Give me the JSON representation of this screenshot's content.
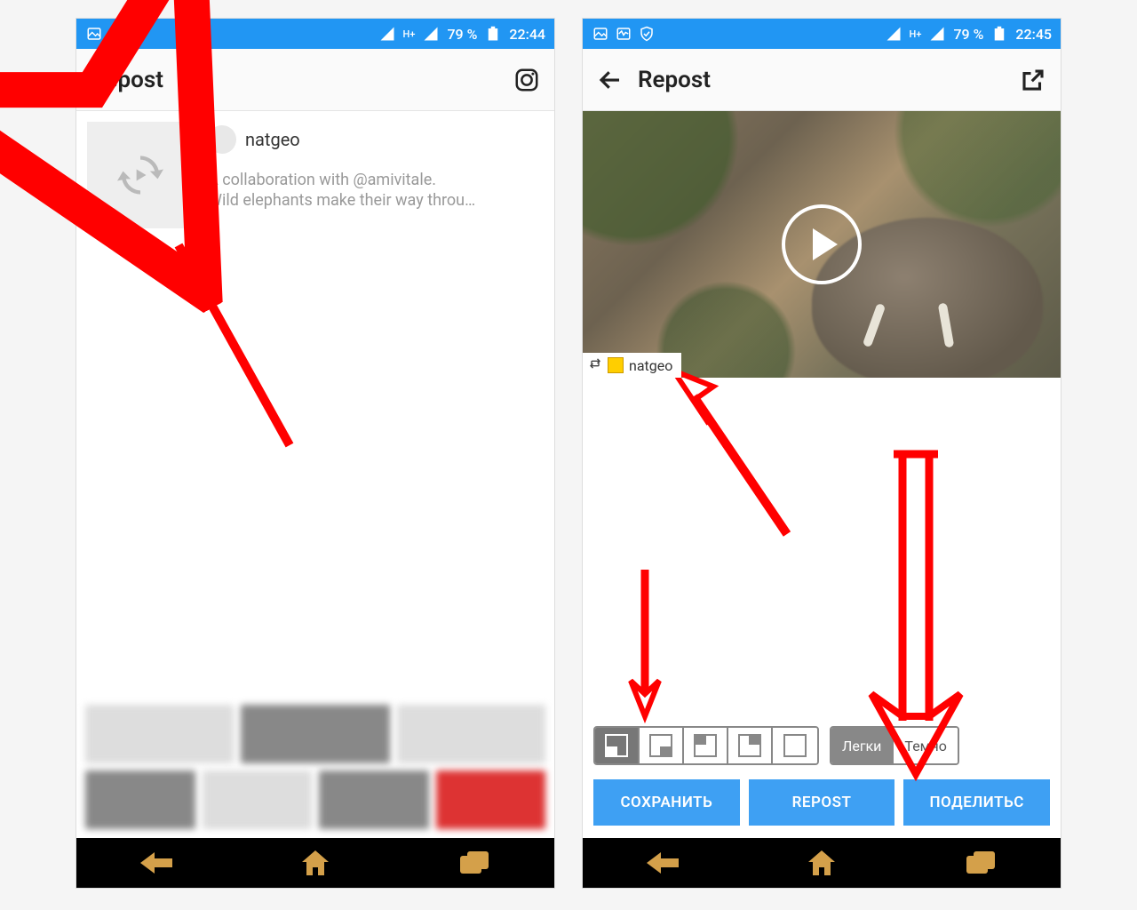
{
  "left": {
    "status": {
      "battery": "79 %",
      "time": "22:44",
      "net_label": "H+"
    },
    "toolbar": {
      "title": "Repost"
    },
    "post": {
      "username": "natgeo",
      "caption_line1": "A collaboration with @amivitale.",
      "caption_line2": "Wild elephants make their way throu…"
    }
  },
  "right": {
    "status": {
      "battery": "79 %",
      "time": "22:45",
      "net_label": "H+"
    },
    "toolbar": {
      "title": "Repost"
    },
    "watermark": {
      "username": "natgeo"
    },
    "theme": {
      "light_label": "Легки",
      "dark_label": "Темно",
      "active": "light"
    },
    "actions": {
      "save": "СОХРАНИТЬ",
      "repost": "REPOST",
      "share": "ПОДЕЛИТЬС"
    }
  }
}
